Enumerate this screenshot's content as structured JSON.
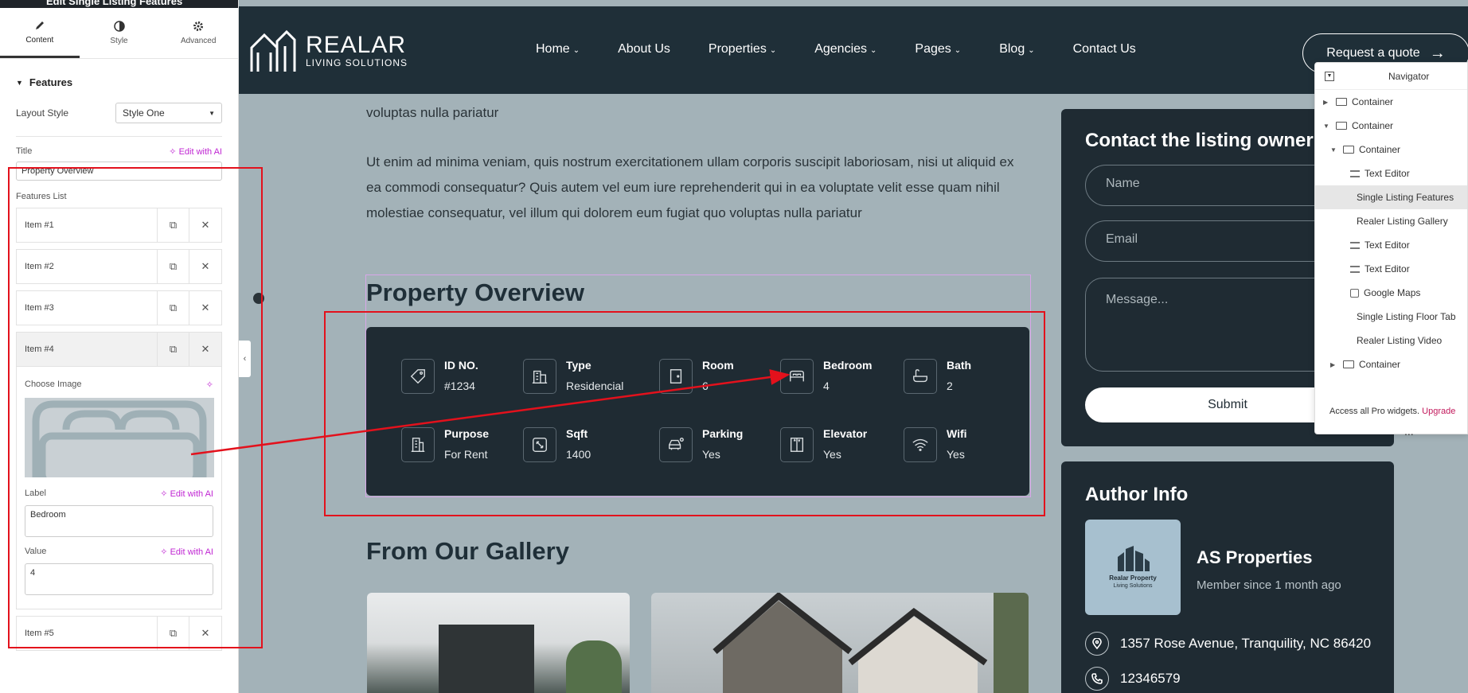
{
  "panel": {
    "title": "Edit Single Listing Features",
    "tabs": [
      {
        "label": "Content",
        "icon": "pencil-icon"
      },
      {
        "label": "Style",
        "icon": "contrast-icon"
      },
      {
        "label": "Advanced",
        "icon": "gear-icon"
      }
    ],
    "section": "Features",
    "layout_style_label": "Layout Style",
    "layout_style_value": "Style One",
    "title_label": "Title",
    "edit_with_ai": "Edit with AI",
    "title_value": "Property Overview",
    "features_list_label": "Features List",
    "items": [
      "Item #1",
      "Item #2",
      "Item #3",
      "Item #4",
      "Item #5"
    ],
    "item_body": {
      "choose_image": "Choose Image",
      "label_label": "Label",
      "label_value": "Bedroom",
      "value_label": "Value",
      "value_value": "4"
    }
  },
  "header": {
    "logo_main": "REALAR",
    "logo_sub": "LIVING SOLUTIONS",
    "nav": [
      {
        "label": "Home",
        "dropdown": true
      },
      {
        "label": "About Us",
        "dropdown": false
      },
      {
        "label": "Properties",
        "dropdown": true
      },
      {
        "label": "Agencies",
        "dropdown": true
      },
      {
        "label": "Pages",
        "dropdown": true
      },
      {
        "label": "Blog",
        "dropdown": true
      },
      {
        "label": "Contact Us",
        "dropdown": false
      }
    ],
    "cta": "Request a quote"
  },
  "content": {
    "para_tail": "voluptas nulla pariatur",
    "para2": "Ut enim ad minima veniam, quis nostrum exercitationem ullam corporis suscipit laboriosam, nisi ut aliquid ex ea commodi consequatur? Quis autem vel eum iure reprehenderit qui in ea voluptate velit esse quam nihil molestiae consequatur, vel illum qui dolorem eum fugiat quo voluptas nulla pariatur",
    "overview_title": "Property Overview",
    "features": [
      {
        "label": "ID NO.",
        "value": "#1234",
        "icon": "tag-icon"
      },
      {
        "label": "Type",
        "value": "Residencial",
        "icon": "building-icon"
      },
      {
        "label": "Room",
        "value": "6",
        "icon": "door-icon"
      },
      {
        "label": "Bedroom",
        "value": "4",
        "icon": "bed-icon"
      },
      {
        "label": "Bath",
        "value": "2",
        "icon": "bathtub-icon"
      },
      {
        "label": "Purpose",
        "value": "For Rent",
        "icon": "office-icon"
      },
      {
        "label": "Sqft",
        "value": "1400",
        "icon": "resize-icon"
      },
      {
        "label": "Parking",
        "value": "Yes",
        "icon": "car-icon"
      },
      {
        "label": "Elevator",
        "value": "Yes",
        "icon": "elevator-icon"
      },
      {
        "label": "Wifi",
        "value": "Yes",
        "icon": "wifi-icon"
      }
    ],
    "gallery_title": "From Our Gallery"
  },
  "contact": {
    "title": "Contact the listing owner",
    "name_ph": "Name",
    "email_ph": "Email",
    "message_ph": "Message...",
    "submit": "Submit"
  },
  "author": {
    "title": "Author Info",
    "logo_line1": "Realar Property",
    "logo_line2": "Living Solutions",
    "name": "AS Properties",
    "since": "Member since 1 month ago",
    "address": "1357 Rose Avenue, Tranquility, NC 86420",
    "phone": "12346579"
  },
  "navigator": {
    "title": "Navigator",
    "items": [
      {
        "label": "Container",
        "indent": 0,
        "caret": "right",
        "icon": "container"
      },
      {
        "label": "Container",
        "indent": 0,
        "caret": "down",
        "icon": "container"
      },
      {
        "label": "Container",
        "indent": 1,
        "caret": "down",
        "icon": "container"
      },
      {
        "label": "Text Editor",
        "indent": 2,
        "caret": "",
        "icon": "text"
      },
      {
        "label": "Single Listing Features",
        "indent": 2,
        "caret": "",
        "icon": "none",
        "selected": true
      },
      {
        "label": "Realer Listing Gallery",
        "indent": 2,
        "caret": "",
        "icon": "none"
      },
      {
        "label": "Text Editor",
        "indent": 2,
        "caret": "",
        "icon": "text"
      },
      {
        "label": "Text Editor",
        "indent": 2,
        "caret": "",
        "icon": "text"
      },
      {
        "label": "Google Maps",
        "indent": 2,
        "caret": "",
        "icon": "map"
      },
      {
        "label": "Single Listing Floor Tab",
        "indent": 2,
        "caret": "",
        "icon": "none"
      },
      {
        "label": "Realer Listing Video",
        "indent": 2,
        "caret": "",
        "icon": "none"
      },
      {
        "label": "Container",
        "indent": 1,
        "caret": "right",
        "icon": "container"
      }
    ],
    "footer_text": "Access all Pro widgets.",
    "footer_link": "Upgrade",
    "more": "..."
  },
  "colors": {
    "page_bg": "#a3b2b8",
    "dark": "#1f2b33",
    "annotation": "#e3111c",
    "ai": "#c026d3"
  }
}
